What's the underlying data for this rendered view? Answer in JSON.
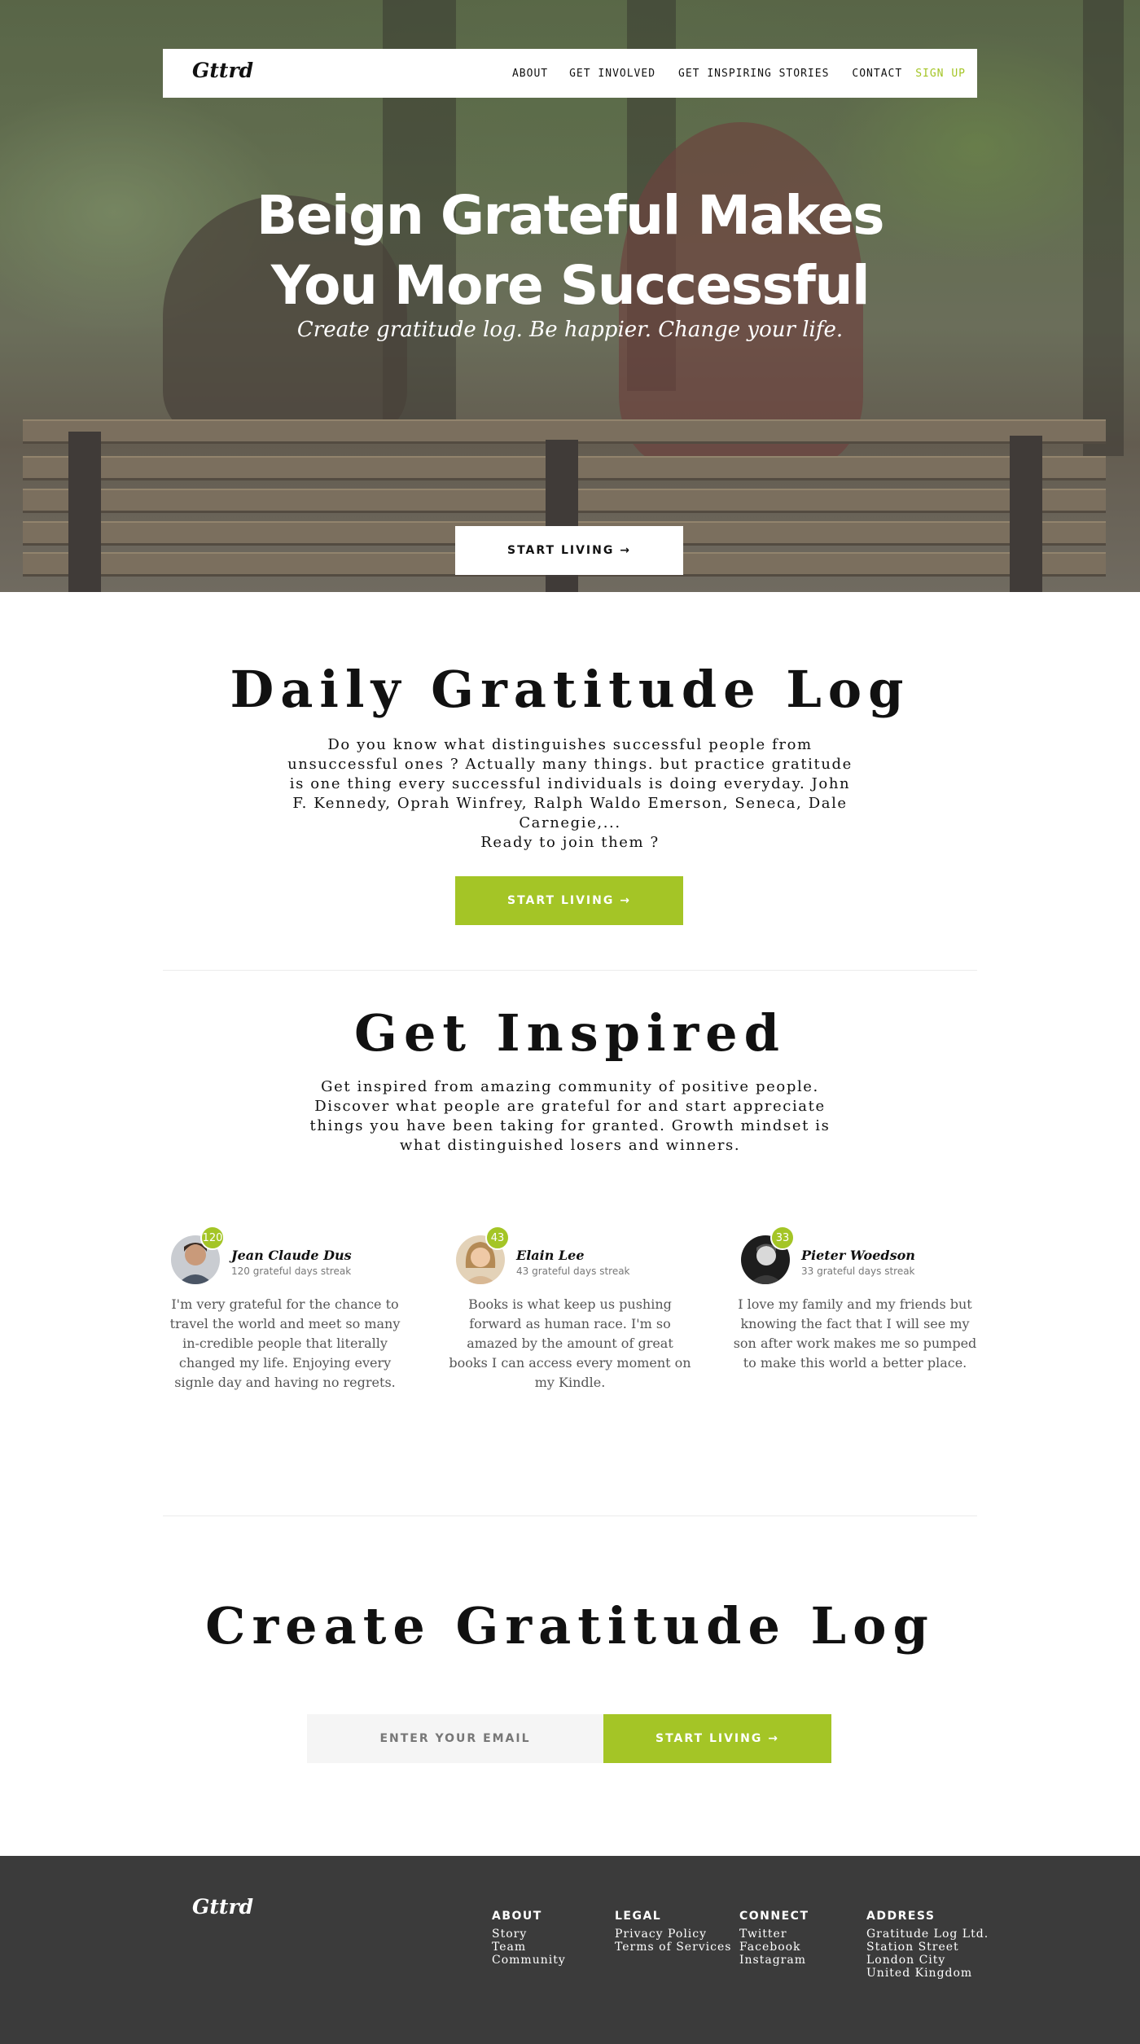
{
  "brand": "Gttrd",
  "nav": {
    "items": [
      "ABOUT",
      "GET INVOLVED",
      "GET INSPIRING STORIES",
      "CONTACT"
    ],
    "signup": "SIGN UP"
  },
  "hero": {
    "title_line1": "Beign Grateful Makes",
    "title_line2": "You More Successful",
    "subtitle": "Create gratitude log. Be happier. Change your life.",
    "cta": "START LIVING →"
  },
  "daily_log": {
    "title": "Daily Gratitude Log",
    "text": "Do you know what distinguishes successful people from unsuccessful ones ? Actually many things. but practice gratitude is one thing every successful individuals is doing everyday. John F. Kennedy, Oprah Winfrey, Ralph Waldo Emerson, Seneca, Dale Carnegie,...",
    "question": "Ready to join them ?",
    "cta": "START LIVING →"
  },
  "inspired": {
    "title": "Get Inspired",
    "text": "Get inspired from amazing community of positive people. Discover what people are grateful for and start appreciate things you have been taking for granted. Growth mindset is what distinguished losers and winners.",
    "testimonials": [
      {
        "name": "Jean Claude Dus",
        "badge": "120",
        "streak": "120 grateful days streak",
        "quote": "I'm very grateful for the chance to travel the world and meet so many in-credible people that literally changed my life. Enjoying every signle day and having no regrets."
      },
      {
        "name": "Elain Lee",
        "badge": "43",
        "streak": "43 grateful days streak",
        "quote": "Books is what keep us pushing forward as human race. I'm so amazed by the amount of great books I can access every moment on my Kindle."
      },
      {
        "name": "Pieter Woedson",
        "badge": "33",
        "streak": "33 grateful days streak",
        "quote": "I love my family and my friends but knowing the fact that I will see my son after work makes me so pumped to make this world a better place."
      }
    ]
  },
  "create": {
    "title": "Create Gratitude Log",
    "email_placeholder": "ENTER YOUR EMAIL",
    "cta": "START LIVING →"
  },
  "footer": {
    "logo": "Gttrd",
    "about": {
      "heading": "ABOUT",
      "links": [
        "Story",
        "Team",
        "Community"
      ]
    },
    "legal": {
      "heading": "LEGAL",
      "links": [
        "Privacy Policy",
        "Terms of Services"
      ]
    },
    "connect": {
      "heading": "CONNECT",
      "links": [
        "Twitter",
        "Facebook",
        "Instagram"
      ]
    },
    "address": {
      "heading": "ADDRESS",
      "lines": [
        "Gratitude Log Ltd.",
        "Station Street",
        "London City",
        "United Kingdom"
      ]
    }
  },
  "colors": {
    "accent": "#a4c526",
    "footer_bg": "#3b3b3b",
    "email_bg": "#f5f5f5"
  }
}
